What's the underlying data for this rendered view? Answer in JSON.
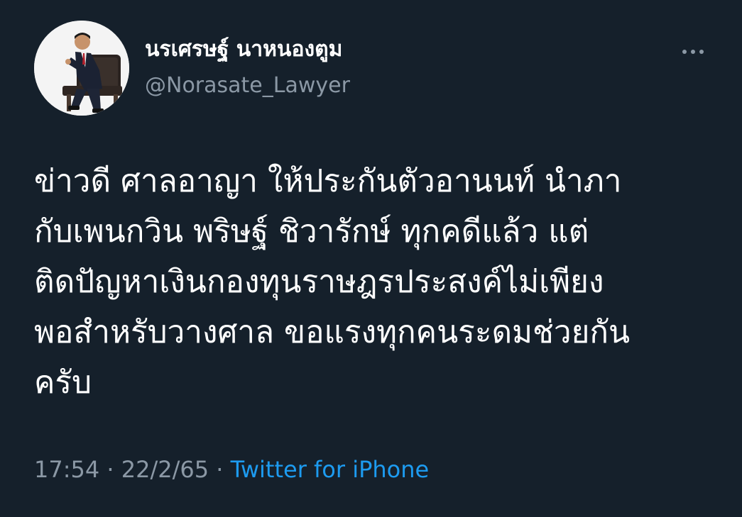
{
  "author": {
    "display_name": "นรเศรษฐ์ นาหนองตูม",
    "handle": "@Norasate_Lawyer"
  },
  "tweet": {
    "lines": [
      "ข่าวดี ศาลอาญา  ให้ประกันตัวอานนท์ นำภา",
      "กับเพนกวิน พริษฐ์ ชิวารักษ์ ทุกคดีแล้ว แต่",
      "ติดปัญหาเงินกองทุนราษฎรประสงค์ไม่เพียง",
      "พอสำหรับวางศาล ขอแรงทุกคนระดมช่วยกัน",
      "ครับ"
    ]
  },
  "meta": {
    "time": "17:54",
    "separator": " · ",
    "date": "22/2/65",
    "source": "Twitter for iPhone"
  },
  "icons": {
    "more": "more-horizontal-icon"
  },
  "colors": {
    "background": "#15202b",
    "primary_text": "#ffffff",
    "secondary_text": "#8b98a5",
    "link": "#1d9bf0"
  }
}
